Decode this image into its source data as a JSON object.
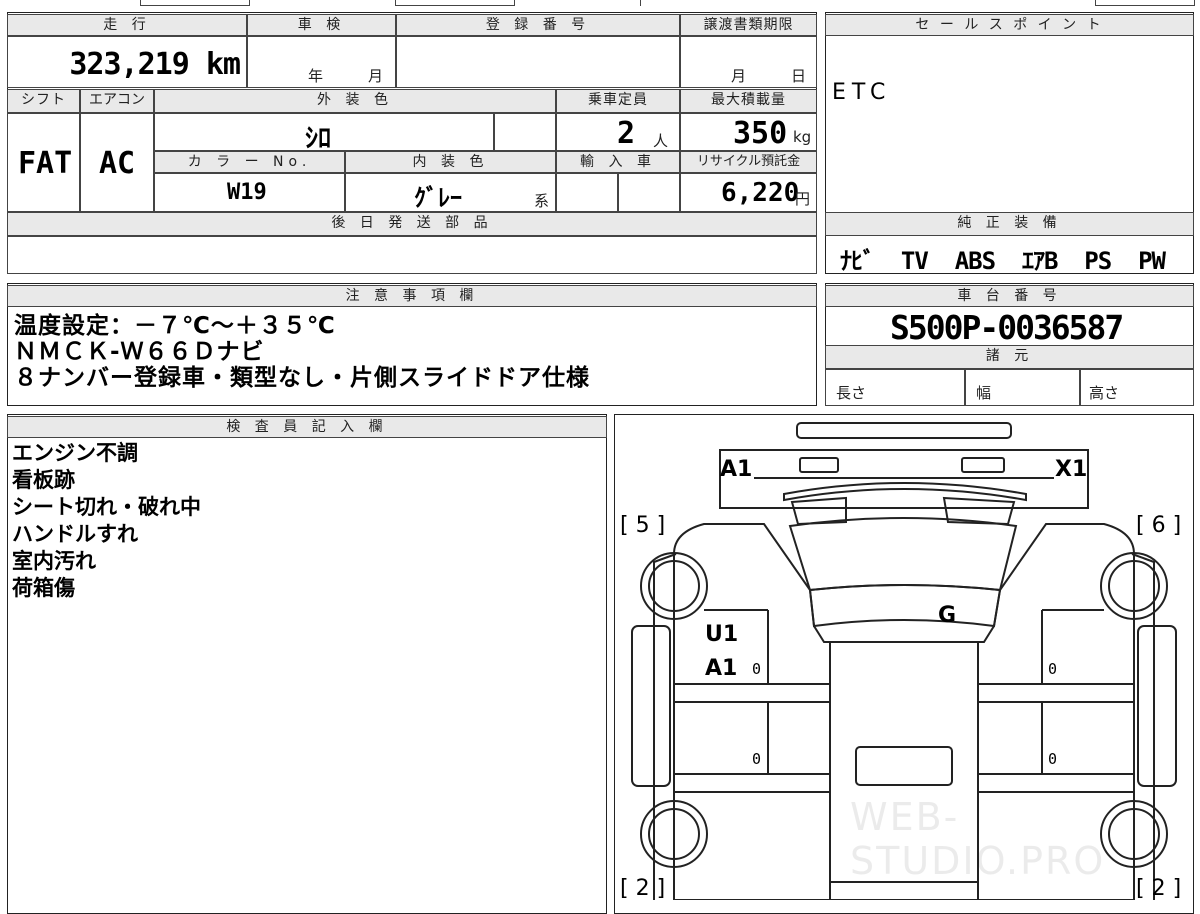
{
  "top": {
    "headers": {
      "mileage": "走 行",
      "shaken": "車 検",
      "reg_no": "登 録 番 号",
      "transfer_deadline": "譲渡書類期限",
      "sales_point": "セ ー ル ス ポ イ ン ト"
    },
    "mileage_value": "323,219 km",
    "shaken_year": "年",
    "shaken_month": "月",
    "transfer_month": "月",
    "transfer_day": "日",
    "sales_point_value": "ETC"
  },
  "row2": {
    "headers": {
      "shift": "シフト",
      "aircon": "エアコン",
      "exterior_color": "外 装 色",
      "capacity": "乗車定員",
      "max_load": "最大積載量",
      "color_no": "カ ラ ー No.",
      "interior_color": "内 装 色",
      "import": "輸 入 車",
      "recycle": "リサイクル預託金"
    },
    "shift_value": "FAT",
    "aircon_value": "AC",
    "exterior_value": "ｼﾛ",
    "capacity_value": "2",
    "capacity_unit": "人",
    "max_load_value": "350",
    "max_load_unit": "kg",
    "color_no_value": "W19",
    "interior_value": "ｸﾞﾚｰ",
    "interior_suffix": "系",
    "recycle_value": "6,220",
    "recycle_unit": "円"
  },
  "parts": {
    "header": "後 日 発 送 部 品"
  },
  "genuine": {
    "header": "純 正 装 備",
    "value": "ﾅﾋﾞ  TV  ABS  ｴｱB  PS  PW"
  },
  "notes": {
    "header": "注 意 事 項 欄",
    "lines": [
      "温度設定：－７℃～＋３５℃",
      "ＮＭＣＫ-Ｗ６６Ｄナビ",
      "８ナンバー登録車・類型なし・片側スライドドア仕様"
    ]
  },
  "chassis": {
    "header": "車 台 番 号",
    "value": "S500P-0036587",
    "spec_header": "諸 元",
    "length": "長さ",
    "width": "幅",
    "height": "高さ"
  },
  "inspector": {
    "header": "検 査 員 記 入 欄",
    "lines": [
      "エンジン不調",
      "看板跡",
      "シート切れ・破れ中",
      "ハンドルすれ",
      "室内汚れ",
      "荷箱傷"
    ]
  },
  "diagram": {
    "front_left": "A1",
    "front_right": "X1",
    "tl_bracket": "[ 5 ]",
    "tr_bracket": "[ 6 ]",
    "bl_bracket": "[ 2 ]",
    "br_bracket": "[ 2 ]",
    "windshield": "G",
    "door_left_1": "U1",
    "door_left_2": "A1",
    "zero": "0",
    "watermark": "WEB-STUDIO.PRO"
  }
}
